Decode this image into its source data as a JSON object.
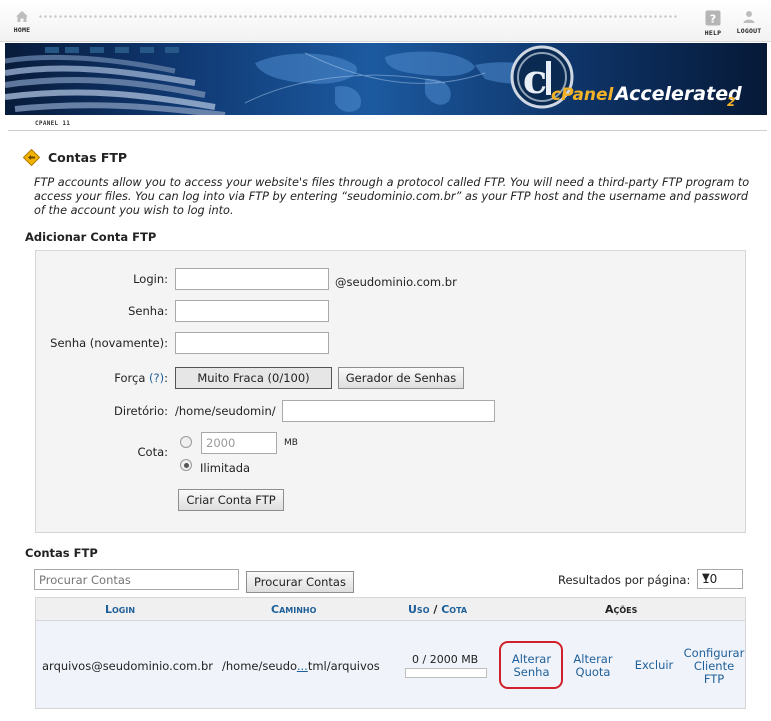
{
  "nav": {
    "home_label": "HOME",
    "help_label": "HELP",
    "logout_label": "LOGOUT"
  },
  "banner": {
    "brand": "cPanel",
    "tagline": "Accelerated",
    "version_mark": "2"
  },
  "breadcrumb": "CPANEL 11",
  "page": {
    "title": "Contas FTP",
    "description": "FTP accounts allow you to access your website's files through a protocol called FTP. You will need a third-party FTP program to access your files. You can log into via FTP by entering “seudominio.com.br” as your FTP host and the username and password of the account you wish to log into."
  },
  "add_form": {
    "heading": "Adicionar Conta FTP",
    "login_label": "Login:",
    "login_value": "",
    "domain_suffix": "@seudominio.com.br",
    "password_label": "Senha:",
    "password_value": "",
    "password_again_label": "Senha (novamente):",
    "password_again_value": "",
    "strength_label": "Força",
    "strength_help": "(?)",
    "strength_colon": ":",
    "strength_value": "Muito Fraca (0/100)",
    "generator_button": "Gerador de Senhas",
    "directory_label": "Diretório:",
    "directory_prefix": "/home/seudomin/",
    "directory_value": "",
    "quota_label": "Cota:",
    "quota_value": "2000",
    "quota_unit": "MB",
    "quota_unlimited_label": "Ilimitada",
    "quota_selected": "Ilimitada",
    "submit_button": "Criar Conta FTP"
  },
  "accounts": {
    "heading": "Contas FTP",
    "search_placeholder": "Procurar Contas",
    "search_button": "Procurar Contas",
    "per_page_label": "Resultados por página:",
    "per_page_value": "10",
    "columns": {
      "login": "Login",
      "path": "Caminho",
      "usage": "Uso",
      "separator": "/",
      "quota": "Cota",
      "actions": "Ações"
    },
    "rows": [
      {
        "login": "arquivos@seudominio.com.br",
        "path_start": "/home/seudo",
        "path_ellipsis": "...",
        "path_end": "tml/arquivos",
        "usage": "0 / 2000 MB",
        "usage_fraction": 0,
        "actions": {
          "change_password_line1": "Alterar",
          "change_password_line2": "Senha",
          "change_quota_line1": "Alterar",
          "change_quota_line2": "Quota",
          "delete": "Excluir",
          "configure_line1": "Configurar",
          "configure_line2": "Cliente",
          "configure_line3": "FTP"
        }
      }
    ]
  },
  "colors": {
    "link": "#1f5f99",
    "highlight": "#d0202a",
    "usage_bar": "#6fb26f"
  }
}
